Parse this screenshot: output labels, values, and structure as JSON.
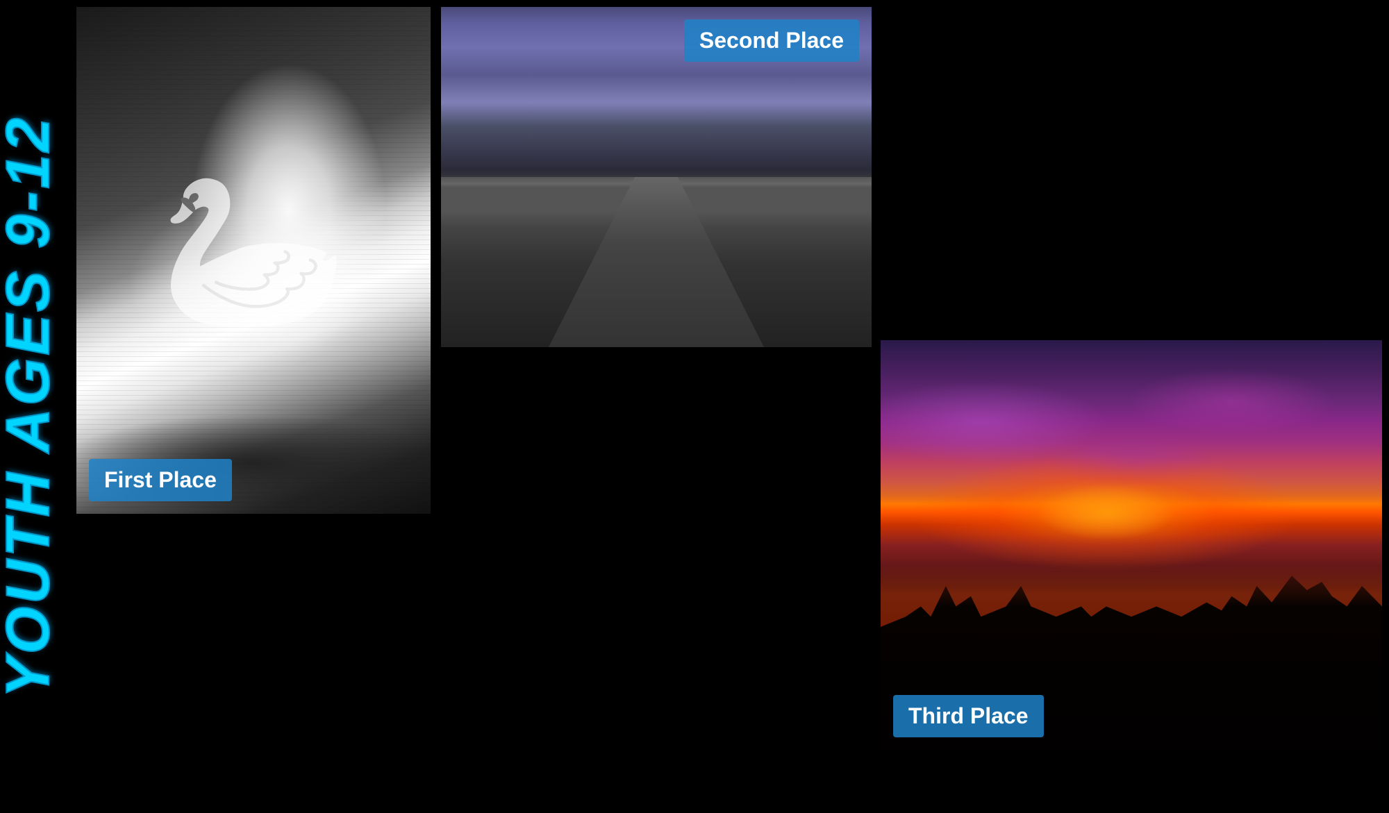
{
  "page": {
    "background": "#000000",
    "title": "YOUTH AGES 9-12"
  },
  "labels": {
    "first_place": "First Place",
    "second_place": "Second Place",
    "third_place": "Third Place"
  },
  "images": {
    "first": {
      "description": "Swan on water - black and white",
      "alt": "First place photo: swan on rippling water"
    },
    "second": {
      "description": "Storm clouds over highway road",
      "alt": "Second place photo: dramatic storm clouds over road"
    },
    "third": {
      "description": "Vibrant sunset over water with silhouettes",
      "alt": "Third place photo: colorful sunset over lake"
    }
  }
}
